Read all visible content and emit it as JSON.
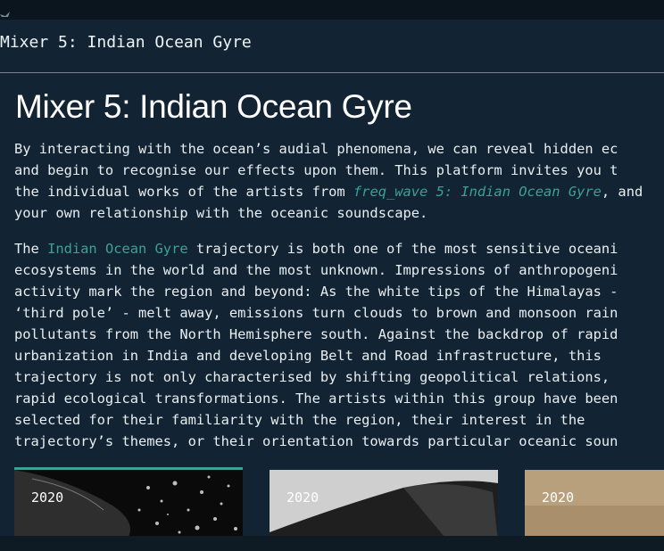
{
  "window": {
    "title": "Mixer 5: Indian Ocean Gyre"
  },
  "page": {
    "heading": "Mixer 5: Indian Ocean Gyre"
  },
  "intro": {
    "line1": "By interacting with the ocean’s audial phenomena, we can reveal hidden ec",
    "line2": "and begin to recognise our effects upon them. This platform invites you t",
    "line3_pre": "the individual works of the artists from ",
    "line3_link": "freq_wave 5: Indian Ocean Gyre",
    "line3_post": ", and",
    "line4": "your own relationship with the oceanic soundscape."
  },
  "body": {
    "line1_pre": "The ",
    "line1_link": "Indian Ocean Gyre",
    "line1_post": " trajectory is both one of the most sensitive oceani",
    "lines": [
      "ecosystems in the world and the most unknown. Impressions of anthropogeni",
      "activity mark the region and beyond: As the white tips of the Himalayas -",
      "‘third pole’ - melt away, emissions turn clouds to brown and monsoon rain",
      "pollutants from the North Hemisphere south. Against the backdrop of rapid",
      "urbanization in India and developing Belt and Road infrastructure, this",
      "trajectory is not only characterised by shifting geopolitical relations,",
      "rapid ecological transformations. The artists within this group have been",
      "selected for their familiarity with the region, their interest in the",
      "trajectory’s themes, or their orientation towards particular oceanic soun"
    ]
  },
  "cards": [
    {
      "year": "2020"
    },
    {
      "year": "2020"
    },
    {
      "year": "2020"
    }
  ],
  "colors": {
    "accent": "#3aa198",
    "background": "#122433",
    "text": "#e8eef1"
  }
}
